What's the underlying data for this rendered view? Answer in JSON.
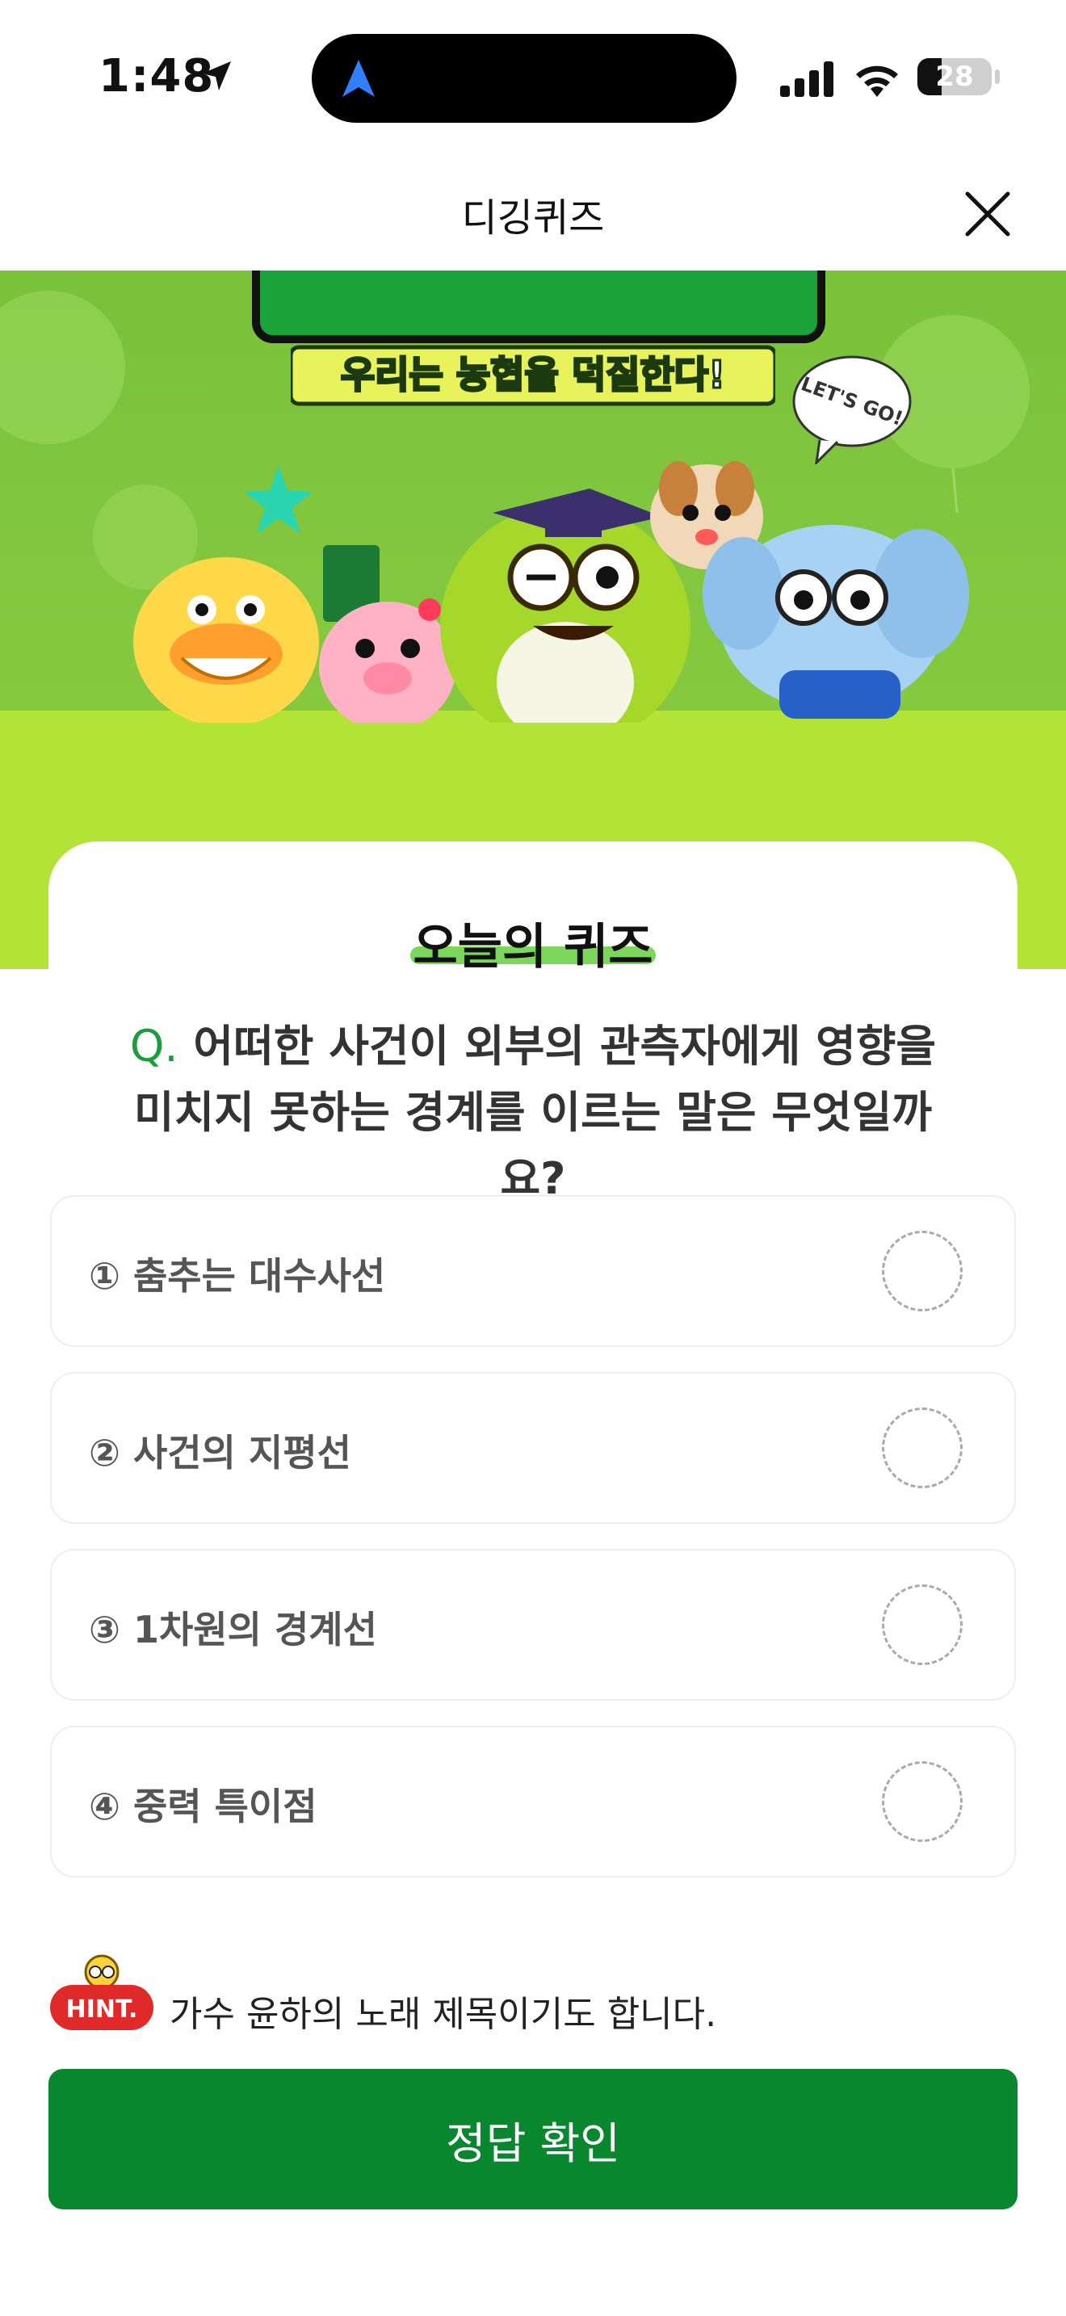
{
  "status_bar": {
    "time": "1:48",
    "battery": "28"
  },
  "header": {
    "title": "디깅퀴즈"
  },
  "banner": {
    "slogan": "우리는 농협을 덕질한다!",
    "bubble": "LET'S GO!"
  },
  "card": {
    "title": "오늘의 퀴즈"
  },
  "question": {
    "prefix": "Q.",
    "text": "어떠한 사건이 외부의 관측자에게 영향을 미치지 못하는 경계를 이르는 말은 무엇일까요?"
  },
  "options": [
    {
      "label": "① 춤추는 대수사선"
    },
    {
      "label": "② 사건의 지평선"
    },
    {
      "label": "③ 1차원의 경계선"
    },
    {
      "label": "④ 중력 특이점"
    }
  ],
  "hint": {
    "badge": "HINT.",
    "text": "가수 윤하의 노래 제목이기도 합니다."
  },
  "cta": {
    "label": "정답 확인"
  },
  "colors": {
    "primary": "#08872e",
    "banner_green": "#7fc535",
    "banner_lime": "#b2e337"
  }
}
